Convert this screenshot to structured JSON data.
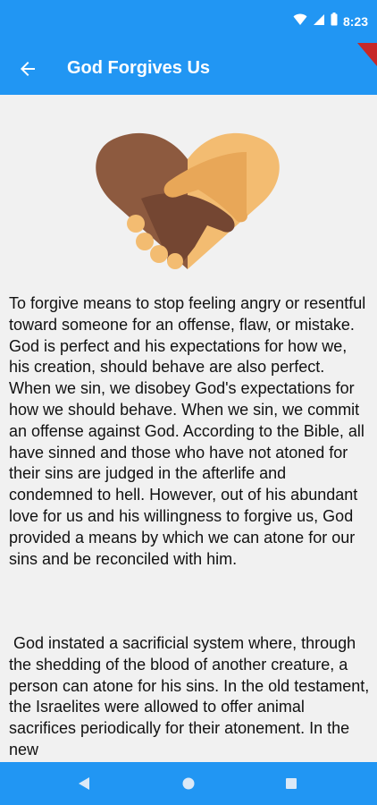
{
  "status_bar": {
    "time": "8:23"
  },
  "app_bar": {
    "title": "God Forgives Us"
  },
  "content": {
    "paragraphs": [
      "To forgive means to stop feeling angry or resentful toward someone for an offense, flaw, or mistake. God is perfect and his expectations for how we, his creation, should behave are also perfect. When we sin, we disobey God's expectations for how we should behave. When we sin, we commit an offense against God. According to the Bible, all have sinned and those who have not atoned for their sins are judged in the afterlife and condemned to hell. However, out of his abundant love for us and his willingness to forgive us, God provided a means by which we can atone for our sins and be reconciled with him.",
      " God instated a sacrificial system where, through the shedding of the blood of another creature, a person can atone for his sins. In the old testament, the Israelites were allowed to offer animal sacrifices periodically for their atonement. In the new"
    ]
  },
  "icons": {
    "wifi": "wifi-icon",
    "signal": "signal-icon",
    "battery": "battery-icon",
    "back": "arrow-back-icon",
    "hero": "heart-handshake-icon",
    "nav_back": "triangle-back-icon",
    "nav_home": "circle-home-icon",
    "nav_recents": "square-recents-icon"
  },
  "colors": {
    "primary": "#2196f3",
    "background": "#f1f1f1",
    "text": "#111111",
    "hand_dark": "#8d5a3f",
    "hand_light": "#f3bc71"
  }
}
